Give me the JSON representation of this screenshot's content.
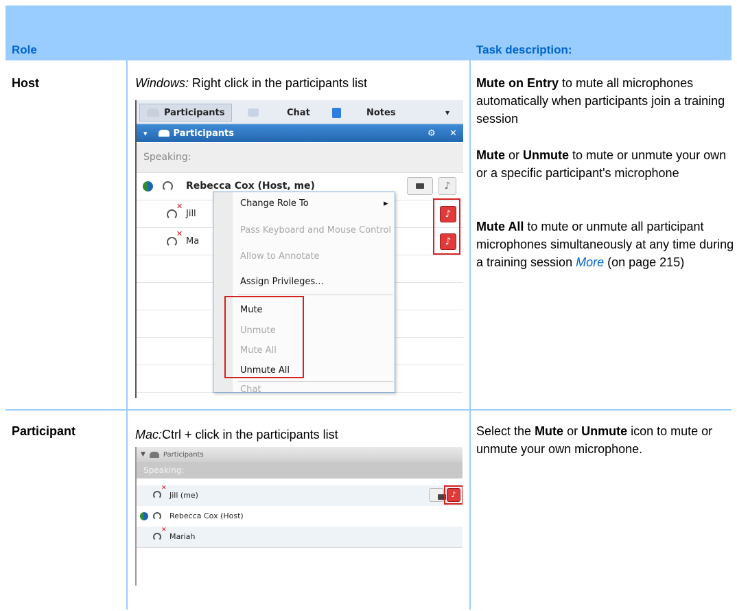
{
  "headers": {
    "role": "Role",
    "task": "Task description:"
  },
  "host": {
    "role": "Host",
    "windows_prefix": "Windows:",
    "windows_text": " Right click in the participants list",
    "task1_bold": "Mute on Entry",
    "task1_rest": " to mute all microphones automatically when participants join a training session",
    "task2_b1": "Mute",
    "task2_or": " or ",
    "task2_b2": "Unmute",
    "task2_rest": " to mute or unmute your own or a specific participant's microphone",
    "task3_bold": "Mute All",
    "task3_rest": " to mute or unmute all participant microphones simultaneously at any time during a training session ",
    "task3_link": "More",
    "task3_tail": " (on page 215)"
  },
  "win_screenshot": {
    "tabs": {
      "participants": "Participants",
      "chat": "Chat",
      "notes": "Notes",
      "caret": "▾"
    },
    "panel_title": "Participants",
    "panel_icons": {
      "gear": "⚙",
      "close": "✕",
      "collapse": "▾"
    },
    "speaking": "Speaking:",
    "rows": {
      "host_name": "Rebecca Cox (Host, me)",
      "jill": "Jill",
      "mariah": "Ma"
    },
    "menu": {
      "change_role": "Change Role To",
      "pass_keyboard": "Pass Keyboard and Mouse Control",
      "annotate": "Allow to Annotate",
      "assign": "Assign Privileges...",
      "mute": "Mute",
      "unmute": "Unmute",
      "mute_all": "Mute All",
      "unmute_all": "Unmute All",
      "chat": "Chat",
      "arrow": "▸"
    }
  },
  "participant": {
    "role": "Participant",
    "mac_prefix": "Mac:",
    "mac_text": "Ctrl + click in the participants list",
    "task_pre": "Select the ",
    "task_b1": "Mute",
    "task_or": " or ",
    "task_b2": "Unmute",
    "task_rest": " icon to mute or unmute your own microphone."
  },
  "mac_screenshot": {
    "panel_title": "Participants",
    "speaking": "Speaking:",
    "jill": "Jill (me)",
    "rebecca": "Rebecca Cox (Host)",
    "mariah": "Mariah"
  }
}
